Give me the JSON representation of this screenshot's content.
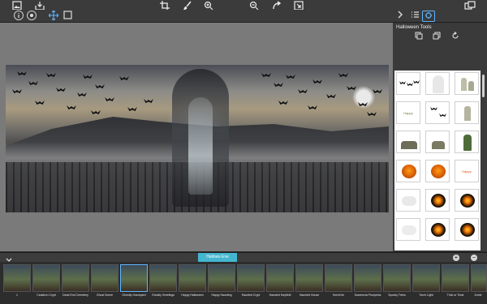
{
  "toolbar": {
    "icons": [
      "image-icon",
      "tray-icon",
      "crop-icon",
      "brush-icon",
      "zoom-in-icon",
      "zoom-out-icon",
      "redo-icon",
      "export-icon",
      "share-icon"
    ]
  },
  "subtoolbar": {
    "icons": [
      "info-icon",
      "target-icon",
      "move-icon",
      "select-icon"
    ]
  },
  "panel": {
    "title": "Halloween Tools",
    "tabs": [
      "chevron-right-icon",
      "list-icon",
      "tools-icon"
    ],
    "tools": [
      "duplicate-icon",
      "layers-icon",
      "rotate-icon"
    ],
    "tiles": [
      {
        "name": "bats",
        "label": ""
      },
      {
        "name": "ghost",
        "label": ""
      },
      {
        "name": "tombstones",
        "label": ""
      },
      {
        "name": "happy-haunting",
        "label": "Happy Haunting"
      },
      {
        "name": "flying-bats",
        "label": ""
      },
      {
        "name": "cross-tombstone",
        "label": ""
      },
      {
        "name": "graves",
        "label": ""
      },
      {
        "name": "grave-small",
        "label": ""
      },
      {
        "name": "zombie-hand",
        "label": ""
      },
      {
        "name": "pumpkin-1",
        "label": ""
      },
      {
        "name": "pumpkin-2",
        "label": ""
      },
      {
        "name": "happy-halloween",
        "label": "Happy Halloween"
      },
      {
        "name": "white-ghost-1",
        "label": ""
      },
      {
        "name": "jackolantern-1",
        "label": ""
      },
      {
        "name": "jackolantern-2",
        "label": ""
      },
      {
        "name": "white-ghost-2",
        "label": ""
      },
      {
        "name": "jackolantern-3",
        "label": ""
      },
      {
        "name": "jackolantern-4",
        "label": ""
      }
    ]
  },
  "album": {
    "active_tab": "Hallows Eve"
  },
  "filmstrip": [
    {
      "label": "1"
    },
    {
      "label": "Cauldron Crypt"
    },
    {
      "label": "Dead End Cemetery"
    },
    {
      "label": "Ghost Scene"
    },
    {
      "label": "Ghostly Graveyard"
    },
    {
      "label": "Ghostly Greetings"
    },
    {
      "label": "Happy Halloween"
    },
    {
      "label": "Happy Haunting"
    },
    {
      "label": "Haunted Crypt"
    },
    {
      "label": "Haunted Hayfield"
    },
    {
      "label": "Haunted House"
    },
    {
      "label": "Horrid Ile"
    },
    {
      "label": "Scarecrow Pumpkins"
    },
    {
      "label": "Spooky Trees"
    },
    {
      "label": "Torch Light"
    },
    {
      "label": "Trick or Treat"
    },
    {
      "label": "Zomb"
    }
  ],
  "colors": {
    "accent": "#45b6d0",
    "selection": "#5fb6ff",
    "toolbar": "#3b3b3b",
    "canvas": "#7a7a7a"
  }
}
